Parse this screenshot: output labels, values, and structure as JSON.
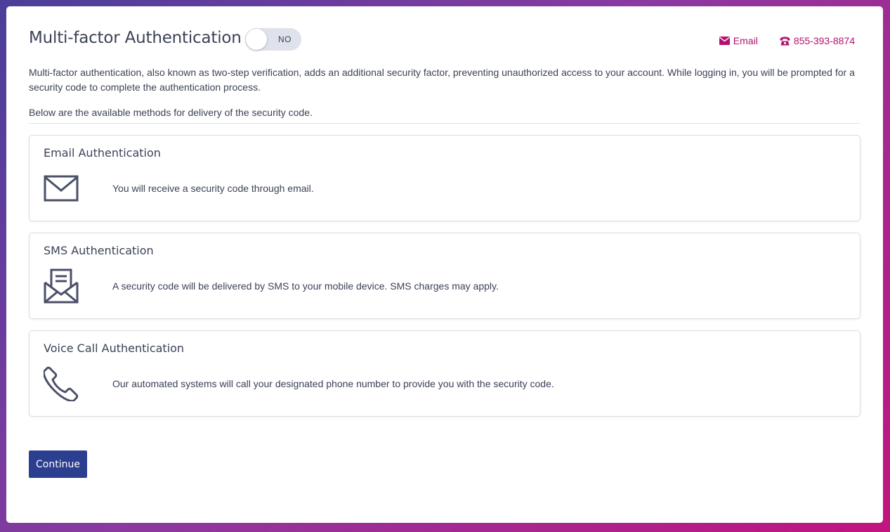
{
  "header": {
    "title": "Multi-factor Authentication",
    "toggle_label": "NO",
    "contact_email_label": "Email",
    "contact_phone_label": "855-393-8874"
  },
  "intro_text": "Multi-factor authentication, also known as two-step verification, adds an additional security factor, preventing unauthorized access to your account. While logging in, you will be prompted for a security code to complete the authentication process.",
  "methods_intro": "Below are the available methods for delivery of the security code.",
  "methods": [
    {
      "title": "Email Authentication",
      "description": "You will receive a security code through email.",
      "icon": "envelope-icon"
    },
    {
      "title": "SMS Authentication",
      "description": "A security code will be delivered by SMS to your mobile device. SMS charges may apply.",
      "icon": "open-envelope-message-icon"
    },
    {
      "title": "Voice Call Authentication",
      "description": "Our automated systems will call your designated phone number to provide you with the security code.",
      "icon": "phone-handset-icon"
    }
  ],
  "continue_label": "Continue",
  "colors": {
    "accent": "#b3116e",
    "primary_button": "#2c3e8f",
    "text": "#3b4256",
    "toggle_bg": "#dfe2ea"
  },
  "toggle_state": "off"
}
